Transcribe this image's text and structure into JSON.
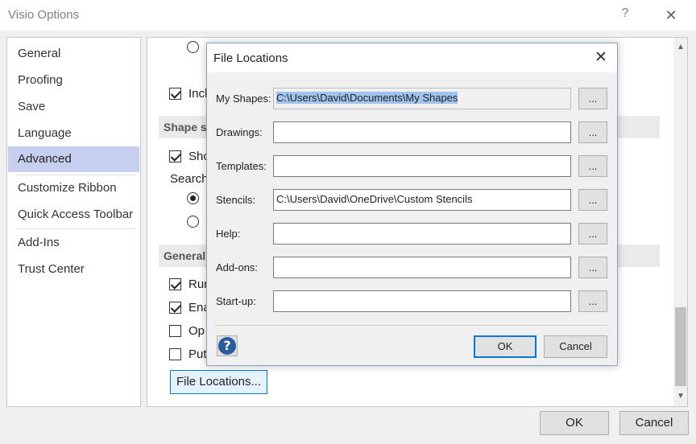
{
  "window": {
    "title": "Visio Options",
    "help_glyph": "?",
    "close_glyph": "✕"
  },
  "nav": {
    "items": [
      {
        "label": "General"
      },
      {
        "label": "Proofing"
      },
      {
        "label": "Save"
      },
      {
        "label": "Language"
      },
      {
        "label": "Advanced",
        "active": true
      },
      {
        "label": "Customize Ribbon"
      },
      {
        "label": "Quick Access Toolbar"
      },
      {
        "label": "Add-Ins"
      },
      {
        "label": "Trust Center"
      }
    ]
  },
  "content": {
    "include_text": "Incl",
    "section_shape": "Shape s",
    "show_text": "Sho",
    "search_text": "Search",
    "section_general": "General",
    "run_text": "Run",
    "ena_text": "Ena",
    "op_text": "Op",
    "put_text": "Put",
    "file_locations_button": "File Locations..."
  },
  "footer": {
    "ok": "OK",
    "cancel": "Cancel"
  },
  "scroll": {
    "up_glyph": "▲",
    "down_glyph": "▼"
  },
  "dialog": {
    "title": "File Locations",
    "close_glyph": "✕",
    "rows": [
      {
        "label": "My Shapes:",
        "value": "C:\\Users\\David\\Documents\\My Shapes",
        "browse": "...",
        "selected": true,
        "disabled": true
      },
      {
        "label": "Drawings:",
        "value": "",
        "browse": "..."
      },
      {
        "label": "Templates:",
        "value": "",
        "browse": "..."
      },
      {
        "label": "Stencils:",
        "value": "C:\\Users\\David\\OneDrive\\Custom Stencils",
        "browse": "..."
      },
      {
        "label": "Help:",
        "value": "",
        "browse": "..."
      },
      {
        "label": "Add-ons:",
        "value": "",
        "browse": "..."
      },
      {
        "label": "Start-up:",
        "value": "",
        "browse": "..."
      }
    ],
    "help_icon_glyph": "?",
    "ok": "OK",
    "cancel": "Cancel"
  }
}
